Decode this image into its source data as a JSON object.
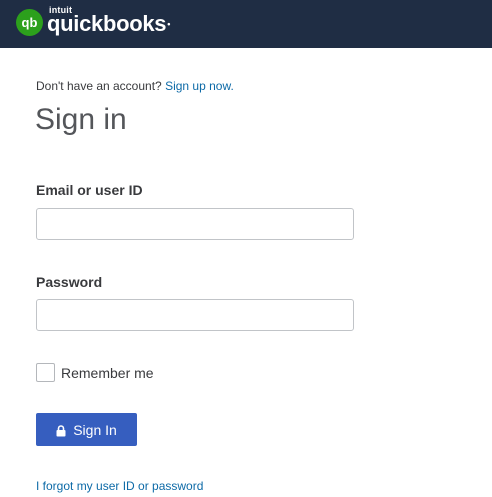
{
  "header": {
    "logo_brand_small": "intuit",
    "logo_brand": "quickbooks",
    "logo_dot": "•",
    "logo_icon": "qb-logo-icon",
    "background_color": "#1f2d44",
    "logo_color": "#2ca01c"
  },
  "account": {
    "prompt": "Don't have an account?",
    "signup_link": "Sign up now."
  },
  "form": {
    "title": "Sign in",
    "email_label": "Email or user ID",
    "email_value": "",
    "password_label": "Password",
    "password_value": "",
    "remember_label": "Remember me",
    "remember_checked": false,
    "submit_label": "Sign In",
    "submit_icon": "lock-icon",
    "submit_color": "#365ebf",
    "forgot_link": "I forgot my user ID or password"
  }
}
